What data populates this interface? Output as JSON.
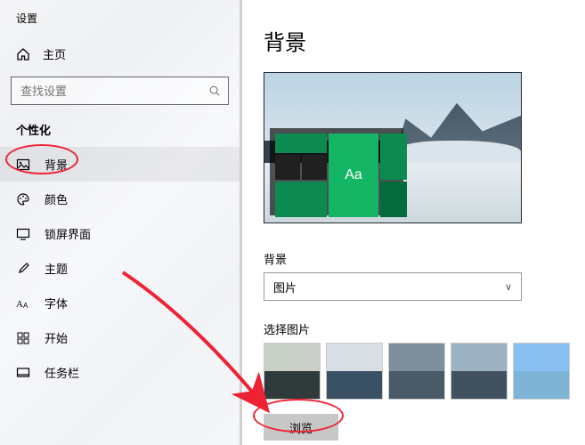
{
  "window_title": "设置",
  "home": "主页",
  "search_placeholder": "查找设置",
  "section": "个性化",
  "nav": [
    {
      "label": "背景"
    },
    {
      "label": "颜色"
    },
    {
      "label": "锁屏界面"
    },
    {
      "label": "主题"
    },
    {
      "label": "字体"
    },
    {
      "label": "开始"
    },
    {
      "label": "任务栏"
    }
  ],
  "page": {
    "heading": "背景",
    "preview_tile_text": "Aa",
    "bg_label": "背景",
    "bg_dropdown_value": "图片",
    "choose_label": "选择图片",
    "browse_button": "浏览"
  }
}
